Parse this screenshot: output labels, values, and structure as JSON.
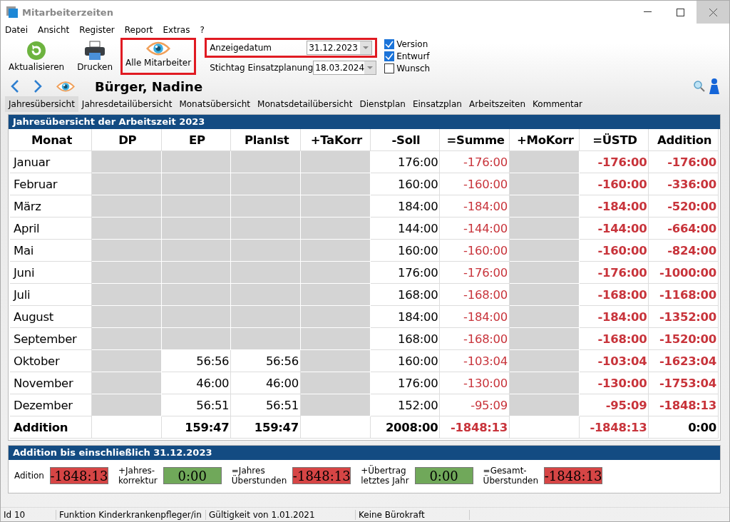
{
  "window": {
    "title": "Mitarbeiterzeiten"
  },
  "menu": [
    "Datei",
    "Ansicht",
    "Register",
    "Report",
    "Extras",
    "?"
  ],
  "toolbar": [
    {
      "label": "Aktualisieren",
      "kind": "refresh",
      "highlighted": false
    },
    {
      "label": "Drucken",
      "kind": "print",
      "highlighted": false
    },
    {
      "label": "Alle Mitarbeiter",
      "kind": "eye",
      "highlighted": true
    }
  ],
  "date_fields": [
    {
      "label": "Anzeigedatum",
      "value": "31.12.2023",
      "highlighted": true
    },
    {
      "label": "Stichtag Einsatzplanung",
      "value": "18.03.2024",
      "highlighted": false
    }
  ],
  "checkboxes": [
    {
      "label": "Version",
      "checked": true
    },
    {
      "label": "Entwurf",
      "checked": true
    },
    {
      "label": "Wunsch",
      "checked": false
    }
  ],
  "employee": {
    "name": "Bürger, Nadine"
  },
  "tabs": [
    {
      "label": "Jahresübersicht",
      "selected": true
    },
    {
      "label": "Jahresdetailübersicht",
      "selected": false
    },
    {
      "label": "Monatsübersicht",
      "selected": false
    },
    {
      "label": "Monatsdetailübersicht",
      "selected": false
    },
    {
      "label": "Dienstplan",
      "selected": false
    },
    {
      "label": "Einsatzplan",
      "selected": false
    },
    {
      "label": "Arbeitszeiten",
      "selected": false
    },
    {
      "label": "Kommentar",
      "selected": false
    }
  ],
  "year_panel": {
    "title": "Jahresübersicht der Arbeitszeit 2023",
    "columns": [
      "Monat",
      "DP",
      "EP",
      "PlanIst",
      "+TaKorr",
      "-Soll",
      "=Summe",
      "+MoKorr",
      "=ÜSTD",
      "Addition"
    ],
    "rows": [
      {
        "total": false,
        "cells": [
          {
            "text": "Januar"
          },
          {
            "shaded": true
          },
          {
            "shaded": true
          },
          {
            "shaded": true
          },
          {
            "shaded": true
          },
          {
            "text": "176:00"
          },
          {
            "text": "-176:00",
            "negative": true
          },
          {
            "shaded": true
          },
          {
            "text": "-176:00",
            "negative": true
          },
          {
            "text": "-176:00",
            "negative": true
          }
        ]
      },
      {
        "total": false,
        "cells": [
          {
            "text": "Februar"
          },
          {
            "shaded": true
          },
          {
            "shaded": true
          },
          {
            "shaded": true
          },
          {
            "shaded": true
          },
          {
            "text": "160:00"
          },
          {
            "text": "-160:00",
            "negative": true
          },
          {
            "shaded": true
          },
          {
            "text": "-160:00",
            "negative": true
          },
          {
            "text": "-336:00",
            "negative": true
          }
        ]
      },
      {
        "total": false,
        "cells": [
          {
            "text": "März"
          },
          {
            "shaded": true
          },
          {
            "shaded": true
          },
          {
            "shaded": true
          },
          {
            "shaded": true
          },
          {
            "text": "184:00"
          },
          {
            "text": "-184:00",
            "negative": true
          },
          {
            "shaded": true
          },
          {
            "text": "-184:00",
            "negative": true
          },
          {
            "text": "-520:00",
            "negative": true
          }
        ]
      },
      {
        "total": false,
        "cells": [
          {
            "text": "April"
          },
          {
            "shaded": true
          },
          {
            "shaded": true
          },
          {
            "shaded": true
          },
          {
            "shaded": true
          },
          {
            "text": "144:00"
          },
          {
            "text": "-144:00",
            "negative": true
          },
          {
            "shaded": true
          },
          {
            "text": "-144:00",
            "negative": true
          },
          {
            "text": "-664:00",
            "negative": true
          }
        ]
      },
      {
        "total": false,
        "cells": [
          {
            "text": "Mai"
          },
          {
            "shaded": true
          },
          {
            "shaded": true
          },
          {
            "shaded": true
          },
          {
            "shaded": true
          },
          {
            "text": "160:00"
          },
          {
            "text": "-160:00",
            "negative": true
          },
          {
            "shaded": true
          },
          {
            "text": "-160:00",
            "negative": true
          },
          {
            "text": "-824:00",
            "negative": true
          }
        ]
      },
      {
        "total": false,
        "cells": [
          {
            "text": "Juni"
          },
          {
            "shaded": true
          },
          {
            "shaded": true
          },
          {
            "shaded": true
          },
          {
            "shaded": true
          },
          {
            "text": "176:00"
          },
          {
            "text": "-176:00",
            "negative": true
          },
          {
            "shaded": true
          },
          {
            "text": "-176:00",
            "negative": true
          },
          {
            "text": "-1000:00",
            "negative": true
          }
        ]
      },
      {
        "total": false,
        "cells": [
          {
            "text": "Juli"
          },
          {
            "shaded": true
          },
          {
            "shaded": true
          },
          {
            "shaded": true
          },
          {
            "shaded": true
          },
          {
            "text": "168:00"
          },
          {
            "text": "-168:00",
            "negative": true
          },
          {
            "shaded": true
          },
          {
            "text": "-168:00",
            "negative": true
          },
          {
            "text": "-1168:00",
            "negative": true
          }
        ]
      },
      {
        "total": false,
        "cells": [
          {
            "text": "August"
          },
          {
            "shaded": true
          },
          {
            "shaded": true
          },
          {
            "shaded": true
          },
          {
            "shaded": true
          },
          {
            "text": "184:00"
          },
          {
            "text": "-184:00",
            "negative": true
          },
          {
            "shaded": true
          },
          {
            "text": "-184:00",
            "negative": true
          },
          {
            "text": "-1352:00",
            "negative": true
          }
        ]
      },
      {
        "total": false,
        "cells": [
          {
            "text": "September"
          },
          {
            "shaded": true
          },
          {
            "shaded": true
          },
          {
            "shaded": true
          },
          {
            "shaded": true
          },
          {
            "text": "168:00"
          },
          {
            "text": "-168:00",
            "negative": true
          },
          {
            "shaded": true
          },
          {
            "text": "-168:00",
            "negative": true
          },
          {
            "text": "-1520:00",
            "negative": true
          }
        ]
      },
      {
        "total": false,
        "cells": [
          {
            "text": "Oktober"
          },
          {
            "shaded": true
          },
          {
            "text": "56:56"
          },
          {
            "text": "56:56"
          },
          {
            "shaded": true
          },
          {
            "text": "160:00"
          },
          {
            "text": "-103:04",
            "negative": true
          },
          {
            "shaded": true
          },
          {
            "text": "-103:04",
            "negative": true
          },
          {
            "text": "-1623:04",
            "negative": true
          }
        ]
      },
      {
        "total": false,
        "cells": [
          {
            "text": "November"
          },
          {
            "shaded": true
          },
          {
            "text": "46:00"
          },
          {
            "text": "46:00"
          },
          {
            "shaded": true
          },
          {
            "text": "176:00"
          },
          {
            "text": "-130:00",
            "negative": true
          },
          {
            "shaded": true
          },
          {
            "text": "-130:00",
            "negative": true
          },
          {
            "text": "-1753:04",
            "negative": true
          }
        ]
      },
      {
        "total": false,
        "cells": [
          {
            "text": "Dezember"
          },
          {
            "shaded": true
          },
          {
            "text": "56:51"
          },
          {
            "text": "56:51"
          },
          {
            "shaded": true
          },
          {
            "text": "152:00"
          },
          {
            "text": "-95:09",
            "negative": true
          },
          {
            "shaded": true
          },
          {
            "text": "-95:09",
            "negative": true
          },
          {
            "text": "-1848:13",
            "negative": true
          }
        ]
      },
      {
        "total": true,
        "cells": [
          {
            "text": "Addition"
          },
          {},
          {
            "text": "159:47"
          },
          {
            "text": "159:47"
          },
          {},
          {
            "text": "2008:00"
          },
          {
            "text": "-1848:13",
            "negative": true
          },
          {},
          {
            "text": "-1848:13",
            "negative": true
          },
          {
            "text": "0:00"
          }
        ]
      }
    ]
  },
  "summary_panel": {
    "title": "Addition bis einschließlich 31.12.2023",
    "items": [
      {
        "label": "Adition",
        "value": "-1848:13",
        "color": "#d64545"
      },
      {
        "label": "+Jahres-\nkorrektur",
        "value": "0:00",
        "color": "#70a85a"
      },
      {
        "label": "=Jahres\nÜberstunden",
        "value": "-1848:13",
        "color": "#d64545"
      },
      {
        "label": "+Übertrag\nletztes Jahr",
        "value": "0:00",
        "color": "#70a85a"
      },
      {
        "label": "=Gesamt-\nÜberstunden",
        "value": "-1848:13",
        "color": "#d64545"
      }
    ]
  },
  "status_bar": [
    "Id 10",
    "Funktion Kinderkrankenpfleger/in",
    "Gültigkeit von 1.01.2021",
    "Keine Bürokraft"
  ]
}
